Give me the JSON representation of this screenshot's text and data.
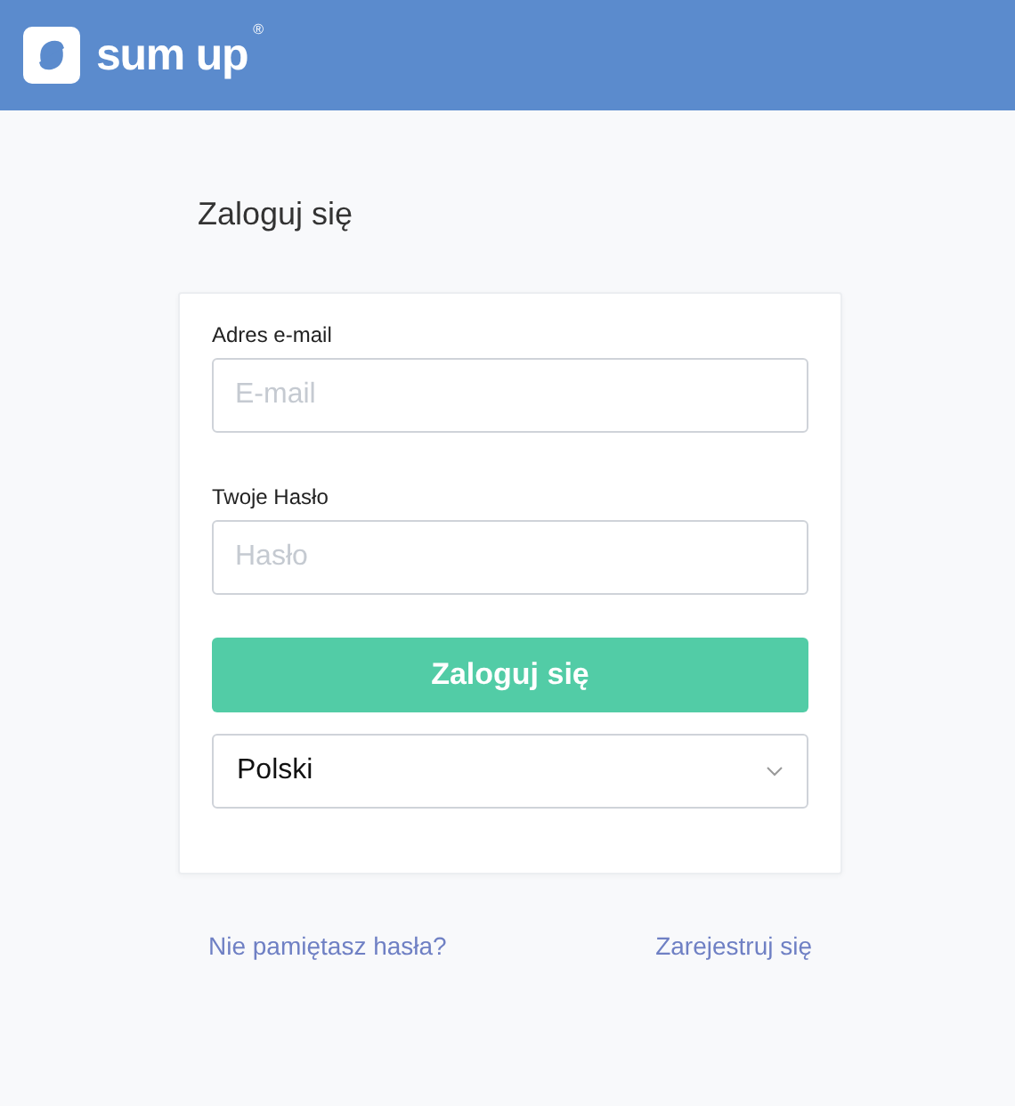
{
  "header": {
    "logo_text": "sum up",
    "logo_mark": "®"
  },
  "title": "Zaloguj się",
  "form": {
    "fields": [
      {
        "label": "Adres e-mail",
        "placeholder": "E-mail"
      },
      {
        "label": "Twoje Hasło",
        "placeholder": "Hasło"
      }
    ],
    "submit": "Zaloguj się",
    "language": "Polski"
  },
  "links": {
    "forgot": "Nie pamiętasz hasła?",
    "register": "Zarejestruj się"
  }
}
